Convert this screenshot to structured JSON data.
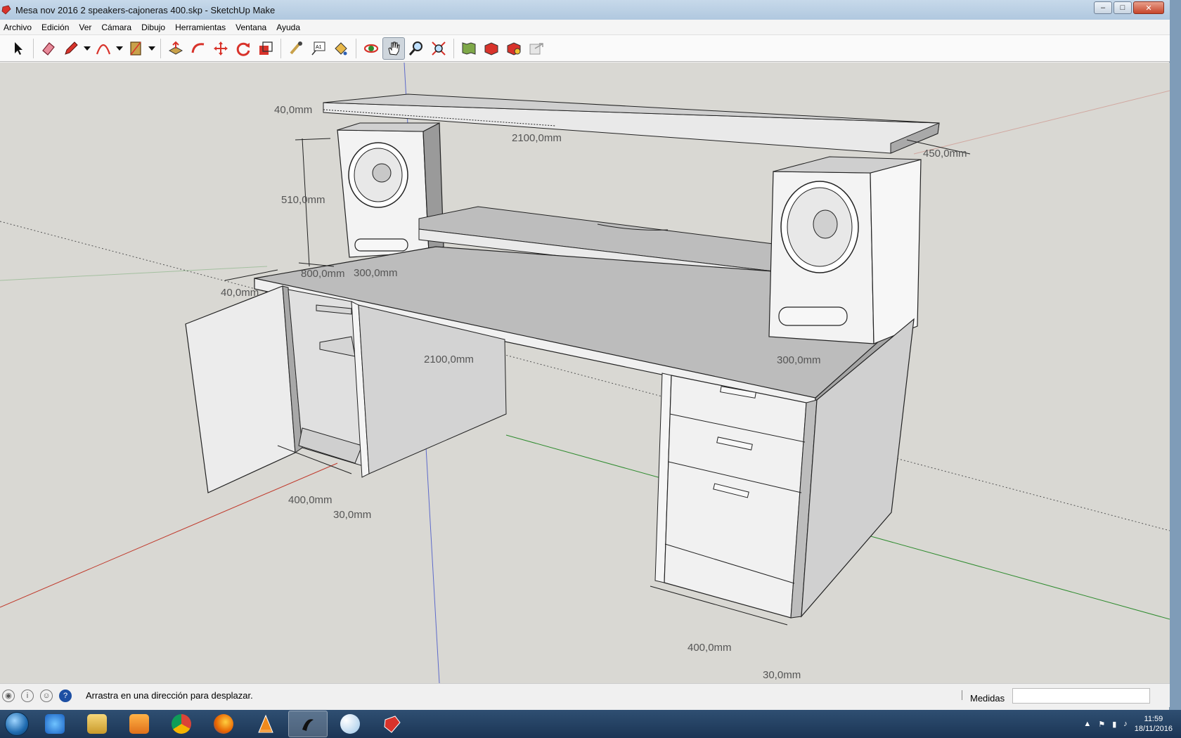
{
  "window": {
    "title": "Mesa nov 2016 2 speakers-cajoneras 400.skp - SketchUp Make",
    "minimize": "–",
    "maximize": "□",
    "close": "✕"
  },
  "menu": [
    "Archivo",
    "Edición",
    "Ver",
    "Cámara",
    "Dibujo",
    "Herramientas",
    "Ventana",
    "Ayuda"
  ],
  "toolbar": {
    "tools": [
      "select-icon",
      "eraser-icon",
      "pencil-icon",
      "arc-icon",
      "rectangle-icon",
      "push-pull-icon",
      "follow-me-icon",
      "move-icon",
      "rotate-icon",
      "scale-icon",
      "tape-measure-icon",
      "text-icon",
      "paint-bucket-icon",
      "orbit-icon",
      "pan-icon",
      "zoom-icon",
      "zoom-extents-icon",
      "warehouse-icon",
      "components-icon",
      "extension-icon",
      "share-icon"
    ],
    "active_tool": "pan-icon"
  },
  "dimensions": {
    "top_shelf_thickness": "40,0mm",
    "top_shelf_length": "2100,0mm",
    "top_shelf_depth": "450,0mm",
    "speaker_height": "510,0mm",
    "speaker_left_width": "300,0mm",
    "desk_thickness": "40,0mm",
    "desk_depth": "800,0mm",
    "desk_length": "2100,0mm",
    "speaker_right_width": "300,0mm",
    "left_cabinet_width": "400,0mm",
    "left_cabinet_panel": "30,0mm",
    "right_cabinet_width": "400,0mm",
    "right_cabinet_panel": "30,0mm"
  },
  "status": {
    "message": "Arrastra en una dirección para desplazar.",
    "measure_label": "Medidas",
    "measure_value": ""
  },
  "taskbar": {
    "apps": [
      "internet-explorer-icon",
      "file-explorer-icon",
      "media-player-icon",
      "chrome-icon",
      "firefox-icon",
      "vlc-icon",
      "inkscape-icon",
      "paint-icon",
      "sketchup-icon"
    ],
    "active_app": "inkscape-icon",
    "time": "11:59",
    "date": "18/11/2016"
  },
  "colors": {
    "viewport_bg": "#d9d8d3",
    "model_face": "#e8e8e8",
    "model_shade": "#bcbcbc",
    "axis_red": "#c0392b",
    "axis_green": "#2e8b2e",
    "axis_blue": "#2a3cc7"
  }
}
